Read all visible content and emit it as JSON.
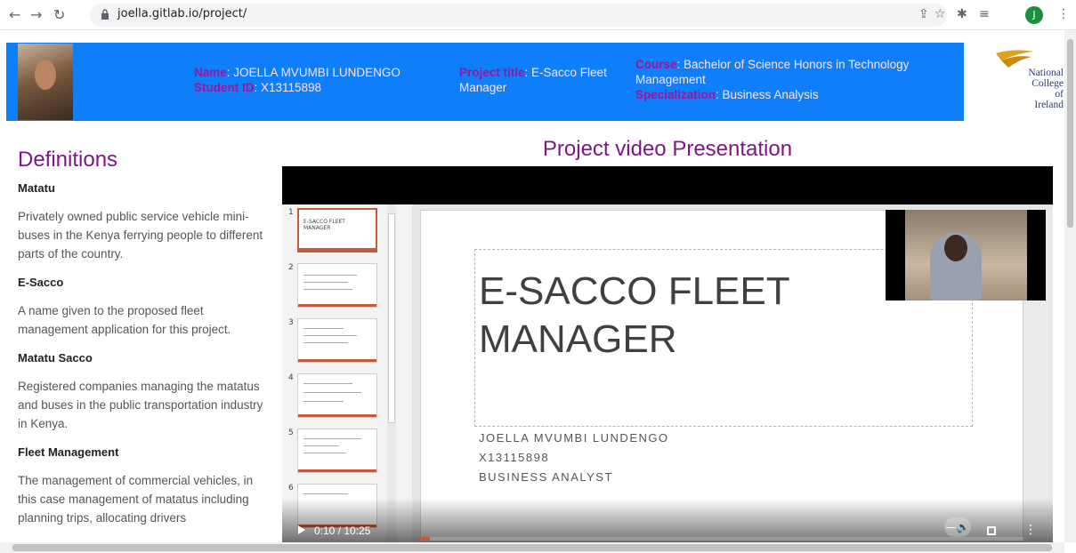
{
  "browser": {
    "url": "joella.gitlab.io/project/",
    "profile_initial": "J",
    "icons": [
      "back-icon",
      "forward-icon",
      "reload-icon",
      "lock-icon",
      "share-icon",
      "bookmark-star-icon",
      "extensions-icon",
      "reading-list-icon",
      "menu-icon"
    ]
  },
  "banner": {
    "name_label": "Name",
    "name_value": ": JOELLA MVUMBI LUNDENGO",
    "id_label": "Student ID",
    "id_value": ": X13115898",
    "project_label": "Project title",
    "project_value": ": E-Sacco Fleet Manager",
    "course_label": "Course",
    "course_value": ": Bachelor of Science Honors in Technology Management",
    "spec_label": "Specialization",
    "spec_value": ": Business Analysis",
    "logo_text_1": "National",
    "logo_text_2": "College of",
    "logo_text_3": "Ireland",
    "banner_color": "#0f7ff9"
  },
  "definitions": {
    "heading": "Definitions",
    "items": [
      {
        "term": "Matatu",
        "text": "Privately owned public service vehicle mini-buses in the Kenya ferrying people to different parts of the country."
      },
      {
        "term": "E-Sacco",
        "text": "A name given to the proposed fleet management application for this project."
      },
      {
        "term": "Matatu Sacco",
        "text": "Registered companies managing the matatus and buses in the public transportation industry in Kenya."
      },
      {
        "term": "Fleet Management",
        "text": "The management of commercial vehicles, in this case management of matatus including planning trips, allocating drivers"
      }
    ]
  },
  "video": {
    "title": "Project video Presentation",
    "time": "0:10 / 10:25",
    "progress": 0.016,
    "slide_title_1": "E-SACCO FLEET",
    "slide_title_2": "MANAGER",
    "slide_sub_1": "JOELLA MVUMBI LUNDENGO",
    "slide_sub_2": "X13115898",
    "slide_sub_3": "BUSINESS ANALYST",
    "thumb_numbers": [
      "1",
      "2",
      "3",
      "4",
      "5",
      "6"
    ],
    "thumb1_title": "E-SACCO FLEET MANAGER"
  }
}
